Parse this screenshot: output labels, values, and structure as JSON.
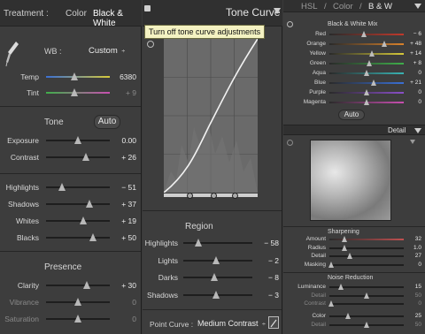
{
  "left": {
    "treatment_label": "Treatment :",
    "treatment_color": "Color",
    "treatment_bw": "Black & White",
    "wb_label": "WB :",
    "wb_value": "Custom",
    "wb_arrows": "÷",
    "temp": {
      "label": "Temp",
      "value": "6380",
      "pos": 0.45
    },
    "tint": {
      "label": "Tint",
      "value": "+ 9",
      "pos": 0.45
    },
    "tone_title": "Tone",
    "auto_label": "Auto",
    "tone_sliders": [
      {
        "label": "Exposure",
        "value": "0.00",
        "pos": 0.5,
        "dim": false
      },
      {
        "label": "Contrast",
        "value": "+ 26",
        "pos": 0.62,
        "dim": false
      }
    ],
    "tone_sliders2": [
      {
        "label": "Highlights",
        "value": "− 51",
        "pos": 0.25
      },
      {
        "label": "Shadows",
        "value": "+ 37",
        "pos": 0.68
      },
      {
        "label": "Whites",
        "value": "+ 19",
        "pos": 0.58
      },
      {
        "label": "Blacks",
        "value": "+ 50",
        "pos": 0.74
      }
    ],
    "presence_title": "Presence",
    "presence_sliders": [
      {
        "label": "Clarity",
        "value": "+ 30",
        "pos": 0.64,
        "dim": false
      },
      {
        "label": "Vibrance",
        "value": "0",
        "pos": 0.5,
        "dim": true
      },
      {
        "label": "Saturation",
        "value": "0",
        "pos": 0.5,
        "dim": true
      }
    ]
  },
  "mid": {
    "title": "Tone Curve",
    "tooltip": "Turn off tone curve adjustments",
    "region_title": "Region",
    "region_sliders": [
      {
        "label": "Highlights",
        "value": "− 58",
        "pos": 0.22
      },
      {
        "label": "Lights",
        "value": "− 2",
        "pos": 0.48
      },
      {
        "label": "Darks",
        "value": "− 8",
        "pos": 0.45
      },
      {
        "label": "Shadows",
        "value": "− 3",
        "pos": 0.48
      }
    ],
    "point_curve_label": "Point Curve :",
    "point_curve_value": "Medium Contrast",
    "point_curve_arrows": "÷"
  },
  "right": {
    "header": {
      "hsl": "HSL",
      "sep1": "/",
      "color": "Color",
      "sep2": "/",
      "bw": "B & W"
    },
    "bw_mix_title": "Black & White Mix",
    "bw_mix": [
      {
        "label": "Red",
        "value": "− 6",
        "pos": 0.47,
        "color": "#c0392b"
      },
      {
        "label": "Orange",
        "value": "+ 48",
        "pos": 0.74,
        "color": "#d9822b"
      },
      {
        "label": "Yellow",
        "value": "+ 14",
        "pos": 0.57,
        "color": "#d6c93a"
      },
      {
        "label": "Green",
        "value": "+ 8",
        "pos": 0.54,
        "color": "#3fae4a"
      },
      {
        "label": "Aqua",
        "value": "0",
        "pos": 0.5,
        "color": "#39b3b3"
      },
      {
        "label": "Blue",
        "value": "+ 21",
        "pos": 0.6,
        "color": "#3a6fd4"
      },
      {
        "label": "Purple",
        "value": "0",
        "pos": 0.5,
        "color": "#8a4fc9"
      },
      {
        "label": "Magenta",
        "value": "0",
        "pos": 0.5,
        "color": "#c94fb0"
      }
    ],
    "bw_auto": "Auto",
    "detail_title": "Detail",
    "sharpening_title": "Sharpening",
    "sharpening": [
      {
        "label": "Amount",
        "value": "32",
        "pos": 0.2,
        "dim": false
      },
      {
        "label": "Radius",
        "value": "1.0",
        "pos": 0.2,
        "dim": false
      },
      {
        "label": "Detail",
        "value": "27",
        "pos": 0.27,
        "dim": false
      },
      {
        "label": "Masking",
        "value": "0",
        "pos": 0.02,
        "dim": false
      }
    ],
    "noise_title": "Noise Reduction",
    "noise": [
      {
        "label": "Luminance",
        "value": "15",
        "pos": 0.15,
        "dim": false
      },
      {
        "label": "Detail",
        "value": "50",
        "pos": 0.5,
        "dim": true
      },
      {
        "label": "Contrast",
        "value": "0",
        "pos": 0.02,
        "dim": true
      }
    ],
    "color_nr": [
      {
        "label": "Color",
        "value": "25",
        "pos": 0.25,
        "dim": false
      },
      {
        "label": "Detail",
        "value": "50",
        "pos": 0.5,
        "dim": true
      }
    ]
  }
}
